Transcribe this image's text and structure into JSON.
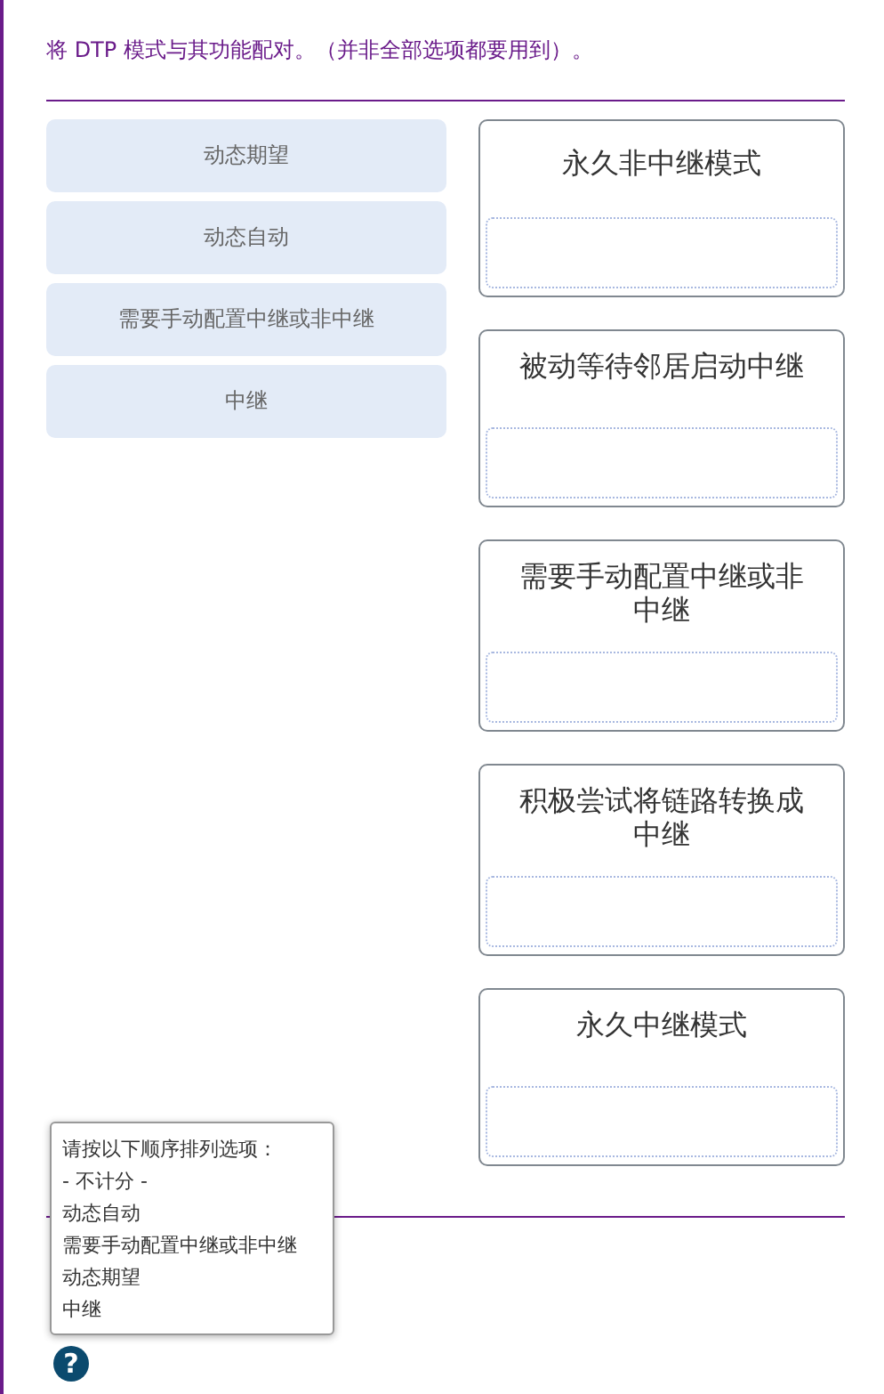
{
  "instruction": "将 DTP 模式与其功能配对。（并非全部选项都要用到）。",
  "options": [
    {
      "label": "动态期望"
    },
    {
      "label": "动态自动"
    },
    {
      "label": "需要手动配置中继或非中继"
    },
    {
      "label": "中继"
    }
  ],
  "targets": [
    {
      "label": "永久非中继模式"
    },
    {
      "label": "被动等待邻居启动中继"
    },
    {
      "label": "需要手动配置中继或非中继"
    },
    {
      "label": "积极尝试将链路转换成中继"
    },
    {
      "label": "永久中继模式"
    }
  ],
  "tooltip": {
    "lines": [
      "请按以下顺序排列选项：",
      "- 不计分 -",
      "动态自动",
      "需要手动配置中继或非中继",
      "动态期望",
      "中继"
    ]
  },
  "help_button": "?"
}
